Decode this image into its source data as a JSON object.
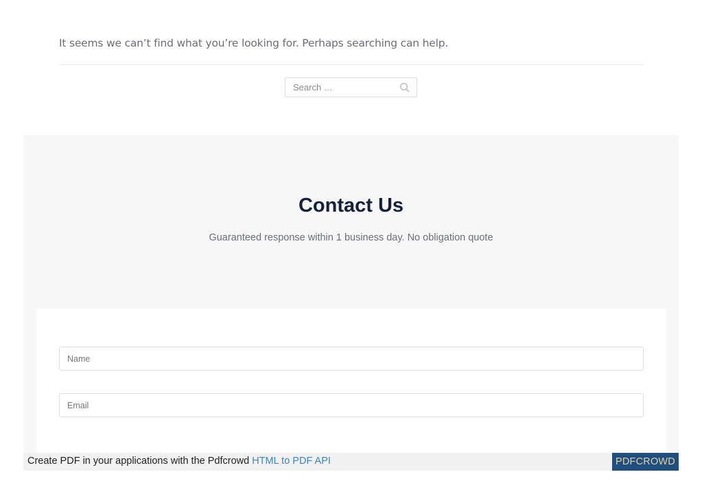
{
  "not_found": {
    "message": "It seems we can’t find what you’re looking for. Perhaps searching can help."
  },
  "search": {
    "placeholder": "Search …",
    "value": "",
    "button_icon": "search-icon"
  },
  "contact": {
    "title": "Contact Us",
    "subtitle": "Guaranteed response within 1 business day. No obligation quote",
    "fields": {
      "name_placeholder": "Name",
      "email_placeholder": "Email"
    }
  },
  "pdf_footer": {
    "text": "Create PDF in your applications with the Pdfcrowd ",
    "link_text": "HTML to PDF API",
    "badge": "PDFCROWD"
  },
  "colors": {
    "title": "#14213d",
    "section_bg": "#f7f7f8",
    "link": "#3b85c6",
    "badge_bg": "#1e4f7e"
  }
}
